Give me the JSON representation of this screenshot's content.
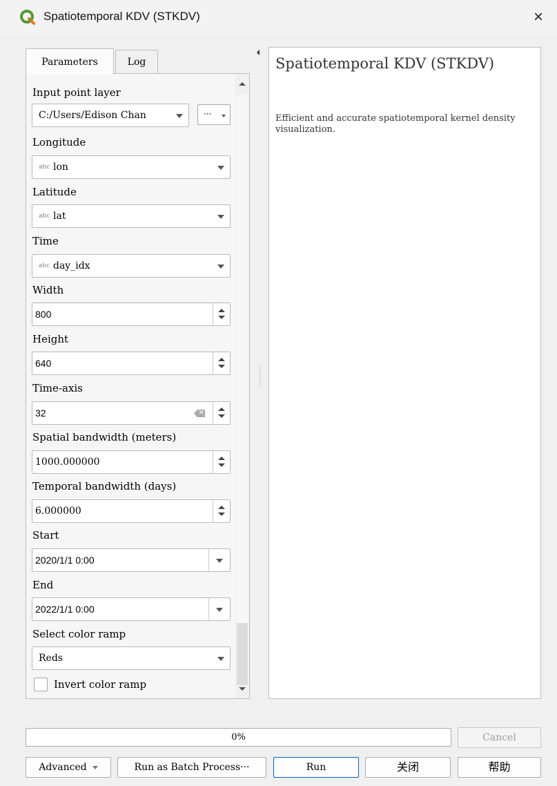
{
  "window": {
    "title": "Spatiotemporal KDV (STKDV)",
    "close_label": "×"
  },
  "tabs": [
    {
      "label": "Parameters",
      "active": true
    },
    {
      "label": "Log",
      "active": false
    }
  ],
  "params": {
    "input_layer": {
      "label": "Input point layer",
      "value": "C:/Users/Edison Chan",
      "button_label": "···"
    },
    "longitude": {
      "label": "Longitude",
      "type_badge": "abc",
      "value": "lon"
    },
    "latitude": {
      "label": "Latitude",
      "type_badge": "abc",
      "value": "lat"
    },
    "time": {
      "label": "Time",
      "type_badge": "abc",
      "value": "day_idx"
    },
    "width": {
      "label": "Width",
      "value": "800"
    },
    "height": {
      "label": "Height",
      "value": "640"
    },
    "time_axis": {
      "label": "Time-axis",
      "value": "32"
    },
    "spatial_bandwidth": {
      "label": "Spatial bandwidth (meters)",
      "value": "1000.000000"
    },
    "temporal_bandwidth": {
      "label": "Temporal bandwidth (days)",
      "value": "6.000000"
    },
    "start": {
      "label": "Start",
      "value": "2020/1/1 0:00"
    },
    "end": {
      "label": "End",
      "value": "2022/1/1 0:00"
    },
    "color_ramp": {
      "label": "Select color ramp",
      "value": "Reds"
    },
    "invert": {
      "label": "Invert color ramp",
      "checked": false
    }
  },
  "help": {
    "title": "Spatiotemporal KDV (STKDV)",
    "description": "Efficient and accurate spatiotemporal kernel density visualization."
  },
  "progress": {
    "value": 0,
    "label": "0%"
  },
  "buttons": {
    "cancel": "Cancel",
    "advanced": "Advanced",
    "batch": "Run as Batch Process···",
    "run": "Run",
    "close": "关闭",
    "help": "帮助"
  },
  "colors": {
    "qgis_green": "#589632",
    "qgis_yellow": "#ee7913",
    "progress_fill": "#06b025",
    "primary_border": "#0067c0"
  },
  "icons": {
    "app": "qgis-logo-icon",
    "close": "close-icon",
    "dropdown": "chevron-down-icon",
    "spin": "spin-arrows-icon",
    "clear": "clear-field-icon"
  }
}
